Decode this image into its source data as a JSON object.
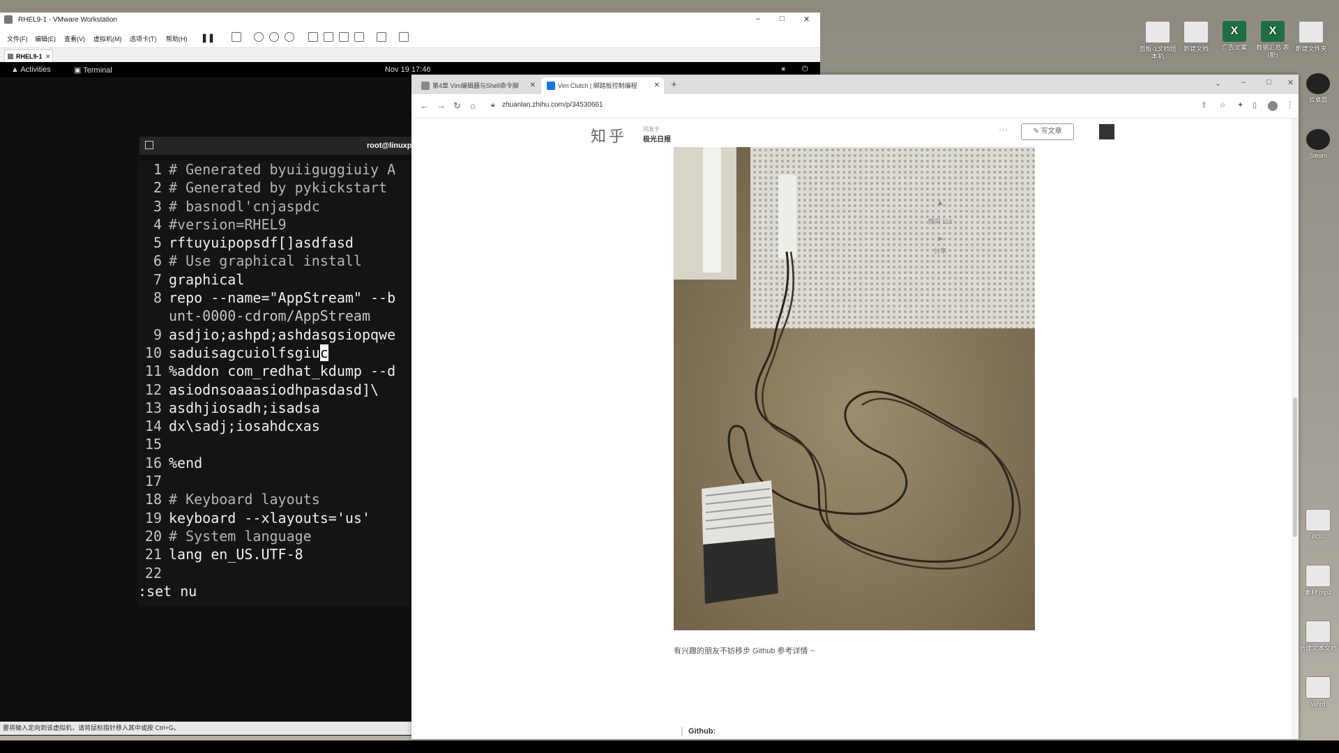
{
  "vmware": {
    "title": "RHEL9-1 - VMware Workstation",
    "menu": [
      "文件(F)",
      "编辑(E)",
      "查看(V)",
      "虚拟机(M)",
      "选项卡(T)",
      "帮助(H)"
    ],
    "tab": "RHEL9-1",
    "status": "要将输入定向到该虚拟机，请将鼠标指针移入其中或按 Ctrl+G。"
  },
  "gnome": {
    "activities": "Activities",
    "app": "Terminal",
    "clock": "Nov 19  17:46"
  },
  "terminal": {
    "header": "root@linuxp",
    "lines": [
      {
        "n": "1",
        "text": "# Generated byuiiguggiuiy A",
        "style": "cm"
      },
      {
        "n": "2",
        "text": "# Generated by pykickstart",
        "style": "cm"
      },
      {
        "n": "3",
        "text": "# basnodl'cnjaspdc",
        "style": "cm"
      },
      {
        "n": "4",
        "text": "#version=RHEL9",
        "style": "cm"
      },
      {
        "n": "5",
        "text": "rftuyuipopsdf[]asdfasd",
        "style": "tx"
      },
      {
        "n": "6",
        "text": "# Use graphical install",
        "style": "cm"
      },
      {
        "n": "7",
        "text": "graphical",
        "style": "tx"
      },
      {
        "n": "8",
        "text": "repo --name=\"AppStream\" --b",
        "style": "tx"
      },
      {
        "n": "",
        "text": "unt-0000-cdrom/AppStream",
        "style": "st"
      },
      {
        "n": "9",
        "text": "asdjio;ashpd;ashdasgsiopqwe",
        "style": "tx"
      },
      {
        "n": "10",
        "text": "saduisagcuiolfsgiu",
        "style": "tx",
        "cursor": "c"
      },
      {
        "n": "11",
        "text": "%addon com_redhat_kdump --d",
        "style": "tx"
      },
      {
        "n": "12",
        "text": "asiodnsoaaasiodhpasdasd]\\",
        "style": "tx"
      },
      {
        "n": "13",
        "text": "asdhjiosadh;isadsa",
        "style": "tx"
      },
      {
        "n": "14",
        "text": "dx\\sadj;iosahdcxas",
        "style": "tx"
      },
      {
        "n": "15",
        "text": "",
        "style": "tx"
      },
      {
        "n": "16",
        "text": "%end",
        "style": "tx"
      },
      {
        "n": "17",
        "text": "",
        "style": "tx"
      },
      {
        "n": "18",
        "text": "# Keyboard layouts",
        "style": "cm"
      },
      {
        "n": "19",
        "text": "keyboard --xlayouts='us'",
        "style": "tx"
      },
      {
        "n": "20",
        "text": "# System language",
        "style": "cm"
      },
      {
        "n": "21",
        "text": "lang en_US.UTF-8",
        "style": "tx"
      },
      {
        "n": "22",
        "text": "",
        "style": "tx"
      }
    ],
    "command": ":set nu"
  },
  "chrome": {
    "tabs": [
      {
        "label": "第4章 Vim编辑器与Shell命令脚"
      },
      {
        "label": "Vim Clutch | 脚踏板控制编程"
      }
    ],
    "url": "zhuanlan.zhihu.com/p/34530661"
  },
  "zhihu": {
    "logo": "知乎",
    "column_label": "同发于",
    "column_name": "极光日报",
    "write_button": "写文章",
    "likes": "赞同 113",
    "share": "分享",
    "caption": "有兴趣的朋友不妨移步 Github 参考详情 ~",
    "github_heading": "Github:"
  },
  "desktop": {
    "icons": [
      {
        "label": "面板-1文档组 本机"
      },
      {
        "label": "新建文档"
      },
      {
        "label": "广告文案"
      },
      {
        "label": "数据汇总 表(新)"
      },
      {
        "label": "新建文件夹"
      }
    ],
    "side_icons": [
      {
        "label": "云桌面"
      },
      {
        "label": "Steam"
      },
      {
        "label": "PDF"
      },
      {
        "label": "素材.mp4"
      },
      {
        "label": "新建文本文档"
      },
      {
        "label": "Word"
      }
    ]
  },
  "colors": {
    "terminal_bg": "#141414",
    "chrome_tab_bg": "#dedede",
    "zhihu_blue": "#0066ff"
  }
}
